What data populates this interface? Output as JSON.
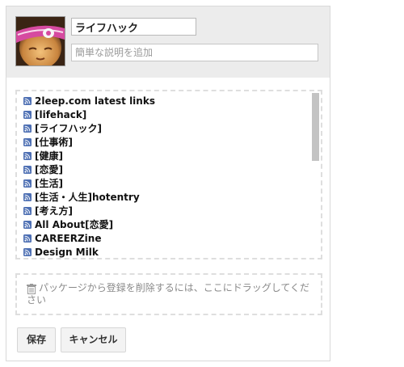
{
  "package": {
    "title_value": "ライフハック",
    "description_placeholder": "簡単な説明を追加"
  },
  "feeds": [
    "2leep.com latest links",
    "[lifehack]",
    "[ライフハック]",
    "[仕事術]",
    "[健康]",
    "[恋愛]",
    "[生活]",
    "[生活・人生]hotentry",
    "[考え方]",
    "All About[恋愛]",
    "CAREERZine",
    "Design Milk"
  ],
  "drop_zone": {
    "text": "パッケージから登録を削除するには、ここにドラッグしてください"
  },
  "buttons": {
    "save": "保存",
    "cancel": "キャンセル"
  },
  "colors": {
    "header_bg": "#ececec",
    "rss_icon": "#4d6fb3"
  }
}
